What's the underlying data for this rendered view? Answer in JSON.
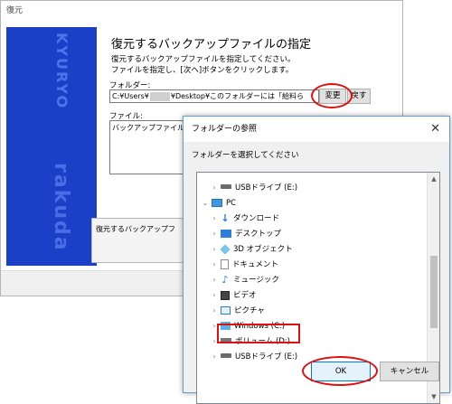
{
  "main_window": {
    "title": "復元",
    "banner_text_top": "KYURYO",
    "banner_text_bottom": "rakuda",
    "heading": "復元するバックアップファイルの指定",
    "desc_line1": "復元するバックアップファイルを指定してください。",
    "desc_line2": "ファイルを指定し、[次へ]ボタンをクリックします。",
    "folder_label": "フォルダー:",
    "folder_path_prefix": "C:¥Users¥",
    "folder_path_suffix": "¥Desktop¥このフォルダーには「給料ら",
    "change_button": "変更",
    "restore_button": "戻す",
    "file_label": "ファイル:",
    "file_list_item": "バックアップファイル",
    "status_text": "復元するバックアップフ"
  },
  "dialog": {
    "title": "フォルダーの参照",
    "close_glyph": "✕",
    "prompt": "フォルダーを選択してください",
    "tree_items": [
      {
        "label": "USBドライブ (E:)",
        "chevron": "›",
        "icon": "drive-icon"
      },
      {
        "label": "PC",
        "chevron": "⌄",
        "icon": "pc-icon"
      },
      {
        "label": "ダウンロード",
        "chevron": "›",
        "icon": "download-icon"
      },
      {
        "label": "デスクトップ",
        "chevron": "›",
        "icon": "desktop-icon"
      },
      {
        "label": "3D オブジェクト",
        "chevron": "›",
        "icon": "3d-objects-icon"
      },
      {
        "label": "ドキュメント",
        "chevron": "›",
        "icon": "document-icon"
      },
      {
        "label": "ミュージック",
        "chevron": "›",
        "icon": "music-icon"
      },
      {
        "label": "ビデオ",
        "chevron": "›",
        "icon": "video-icon"
      },
      {
        "label": "ピクチャ",
        "chevron": "›",
        "icon": "pictures-icon"
      },
      {
        "label": "Windows (C:)",
        "chevron": "›",
        "icon": "windows-drive-icon"
      },
      {
        "label": "ボリューム (D:)",
        "chevron": "›",
        "icon": "volume-icon"
      },
      {
        "label": "USBドライブ (E:)",
        "chevron": "›",
        "icon": "drive-icon"
      }
    ],
    "ok_button": "OK",
    "cancel_button": "キャンセル"
  },
  "colors": {
    "banner": "#1c3fc8",
    "highlight_ring": "#e01010",
    "ok_border": "#0078d7"
  }
}
